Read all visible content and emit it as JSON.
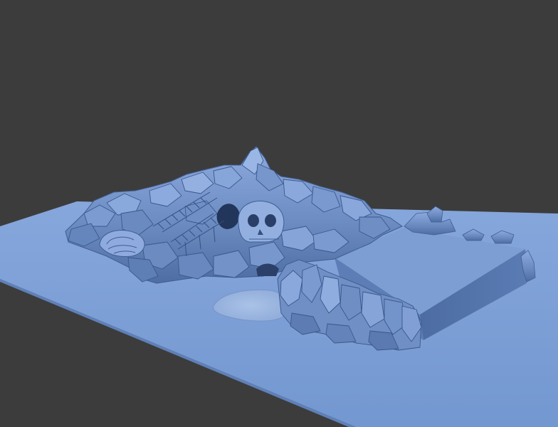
{
  "viewport": {
    "background_color": "#3c3c3c"
  },
  "scene": {
    "ground_color": "#7b9fd6",
    "rock_color": "#6f8fc4",
    "rock_shadow_color": "#3f5d92",
    "rock_highlight_color": "#a6c1ea",
    "slab_top_color": "#7d9ed2",
    "slab_side_color": "#4d6ea6",
    "sand_color": "#9db8e0",
    "elements": [
      "ground-plane",
      "rock-mountain",
      "skull-rock",
      "cave-opening",
      "stairway",
      "coiled-tentacle-rock",
      "rock-cliff",
      "raised-slab",
      "sand-pool"
    ]
  }
}
